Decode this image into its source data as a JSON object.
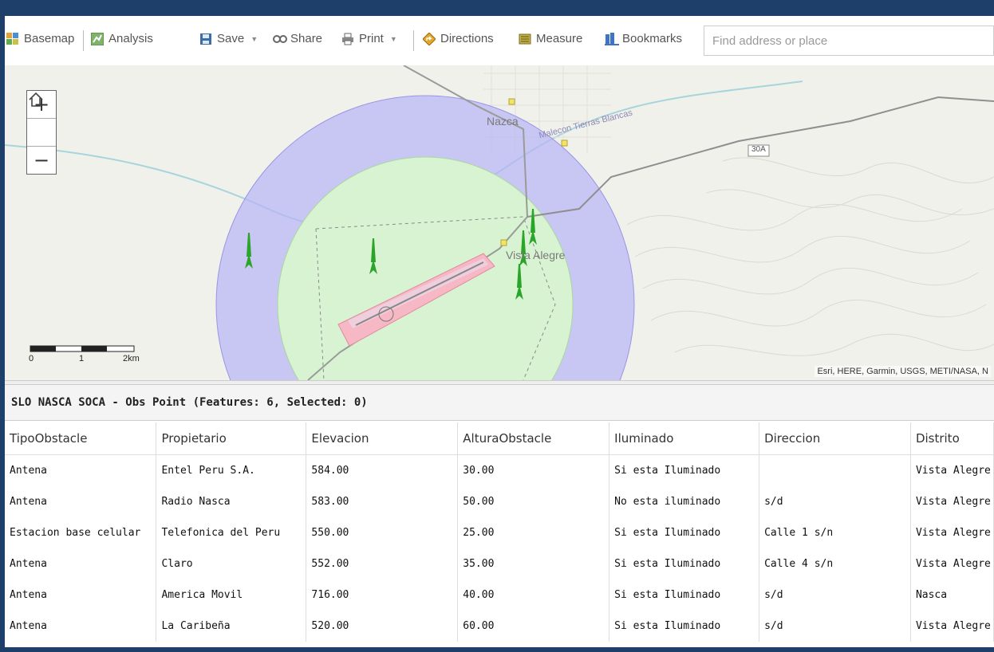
{
  "toolbar": {
    "basemap": "Basemap",
    "analysis": "Analysis",
    "save": "Save",
    "share": "Share",
    "print": "Print",
    "directions": "Directions",
    "measure": "Measure",
    "bookmarks": "Bookmarks",
    "search_placeholder": "Find address or place"
  },
  "map": {
    "labels": {
      "nazca": "Nazca",
      "malecon": "Malecon Tierras Blancas",
      "vista_alegre": "Vista Alegre",
      "highway": "30A"
    },
    "scale": {
      "zero": "0",
      "one": "1",
      "two": "2km"
    },
    "attribution": "Esri, HERE, Garmin, USGS, METI/NASA, N",
    "zoom_in": "+",
    "zoom_out": "−",
    "colors": {
      "outer_ring": "#b7b3f5",
      "inner_circle": "#d8f5d0",
      "runway_zone": "#f6b8c4",
      "antenna": "#2aa52a"
    }
  },
  "table": {
    "title": "SLO NASCA SOCA - Obs Point (Features: 6, Selected: 0)",
    "columns": [
      "TipoObstacle",
      "Propietario",
      "Elevacion",
      "AlturaObstacle",
      "Iluminado",
      "Direccion",
      "Distrito"
    ],
    "rows": [
      [
        "Antena",
        "Entel Peru S.A.",
        "584.00",
        "30.00",
        "Si esta Iluminado",
        "",
        "Vista Alegre"
      ],
      [
        "Antena",
        "Radio Nasca",
        "583.00",
        "50.00",
        "No esta iluminado",
        "s/d",
        "Vista Alegre"
      ],
      [
        "Estacion base celular",
        "Telefonica del Peru",
        "550.00",
        "25.00",
        "Si esta Iluminado",
        "Calle 1 s/n",
        "Vista Alegre"
      ],
      [
        "Antena",
        "Claro",
        "552.00",
        "35.00",
        "Si esta Iluminado",
        "Calle 4 s/n",
        "Vista Alegre"
      ],
      [
        "Antena",
        "America Movil",
        "716.00",
        "40.00",
        "Si esta Iluminado",
        "s/d",
        "Nasca"
      ],
      [
        "Antena",
        "La Caribeña",
        "520.00",
        "60.00",
        "Si esta Iluminado",
        "s/d",
        "Vista Alegre"
      ]
    ]
  }
}
